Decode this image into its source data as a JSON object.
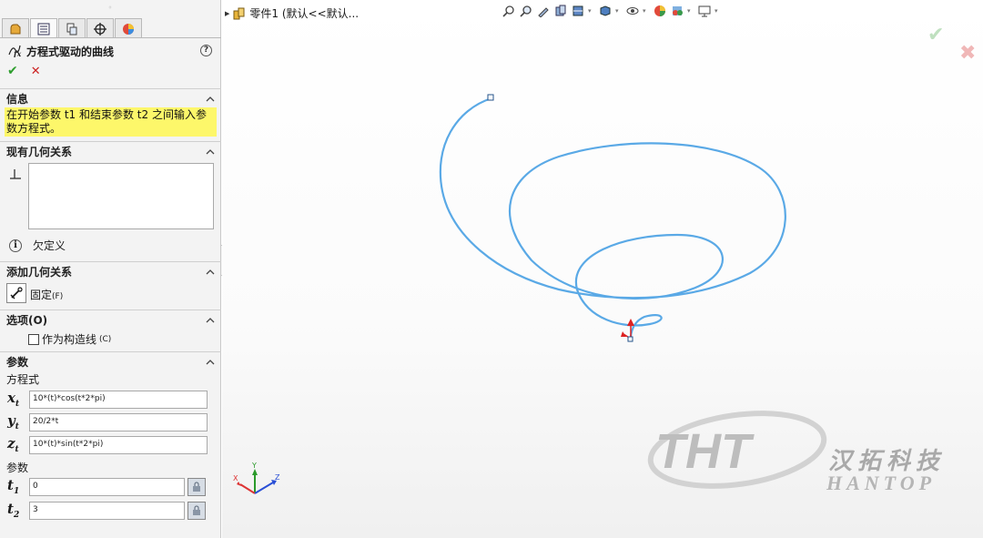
{
  "property_manager": {
    "title": "方程式驱动的曲线",
    "tabs": [
      "feature-manager-icon",
      "property-manager-icon",
      "configuration-manager-icon",
      "dimxpert-icon",
      "display-manager-icon"
    ],
    "info": {
      "header": "信息",
      "message": "在开始参数 t1 和结束参数 t2 之间输入参数方程式。"
    },
    "existing_relations": {
      "header": "现有几何关系",
      "status": "欠定义"
    },
    "add_relations": {
      "header": "添加几何关系",
      "fix_label": "固定",
      "fix_mnemonic": "(F)"
    },
    "options": {
      "header": "选项(O)",
      "construction_label": "作为构造线",
      "construction_mnemonic": "(C)",
      "construction_checked": false
    },
    "parameters": {
      "header": "参数",
      "equation_label": "方程式",
      "x_var": "x",
      "y_var": "y",
      "z_var": "z",
      "t_sub": "t",
      "x_expr": "10*(t)*cos(t*2*pi)",
      "y_expr": "20/2*t",
      "z_expr": "10*(t)*sin(t*2*pi)",
      "param_label": "参数",
      "t_var": "t",
      "t1_sub": "1",
      "t2_sub": "2",
      "t1_value": "0",
      "t2_value": "3"
    }
  },
  "viewport": {
    "tree_node": "零件1 (默认<<默认...",
    "hud_icons": [
      "zoom-to-fit-icon",
      "zoom-area-icon",
      "previous-view-icon",
      "section-view-icon",
      "view-orientation-icon",
      "display-style-icon",
      "hide-show-icon",
      "edit-appearance-icon",
      "apply-scene-icon",
      "view-settings-icon"
    ],
    "axis_labels": {
      "x": "X",
      "y": "Y",
      "z": "Z"
    },
    "curve_color": "#5aa9e6"
  },
  "watermark": {
    "logo": "THT",
    "chinese": "汉拓科技",
    "english": "HANTOP"
  }
}
